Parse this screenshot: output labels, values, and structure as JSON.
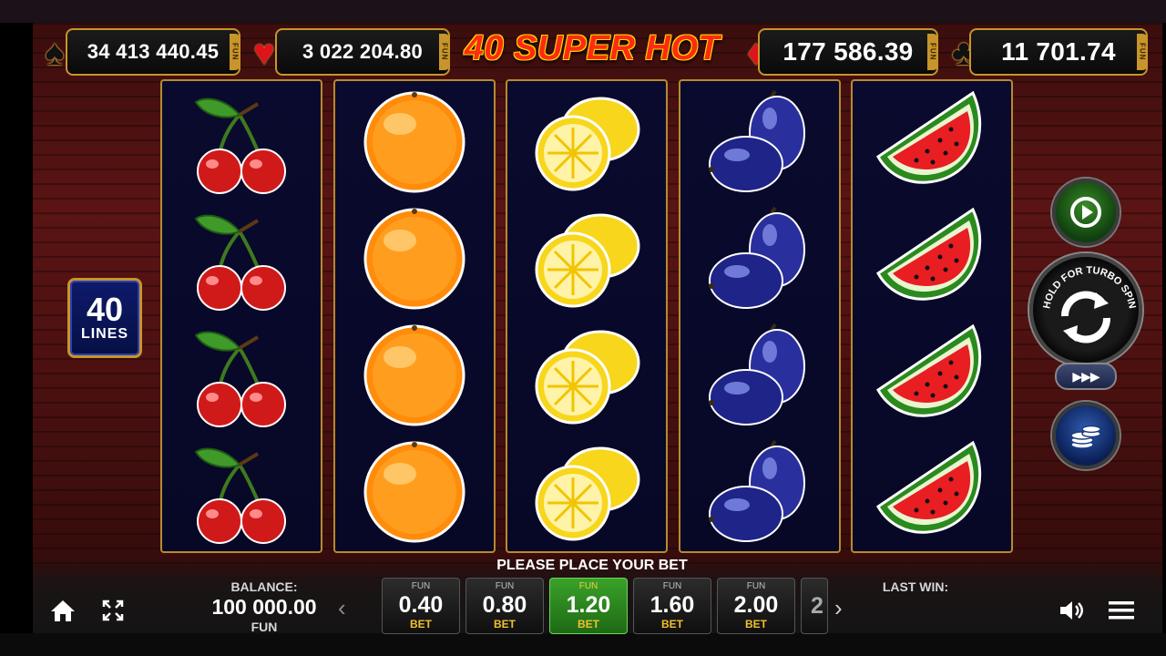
{
  "jackpots": [
    {
      "suit": "spade",
      "value": "34 413 440.45",
      "tag": "FUN"
    },
    {
      "suit": "heart",
      "value": "3 022 204.80",
      "tag": "FUN"
    },
    {
      "suit": "diamond",
      "value": "177 586.39",
      "tag": "FUN"
    },
    {
      "suit": "club",
      "value": "11 701.74",
      "tag": "FUN"
    }
  ],
  "suits": {
    "spade": "♠",
    "heart": "♥",
    "diamond": "♦",
    "club": "♣"
  },
  "title": "40 SUPER HOT",
  "lines": {
    "count": "40",
    "label": "LINES"
  },
  "reels": [
    {
      "symbol": "cherries",
      "rows": 4
    },
    {
      "symbol": "orange",
      "rows": 4
    },
    {
      "symbol": "lemon",
      "rows": 4
    },
    {
      "symbol": "plum",
      "rows": 4
    },
    {
      "symbol": "watermelon",
      "rows": 4
    }
  ],
  "controls": {
    "autoplay_icon": "replay-icon",
    "spin_hint": "HOLD FOR TURBO SPIN",
    "turbo_label": "▶▶▶",
    "bet_stack_icon": "coins-icon"
  },
  "bet_panel": {
    "prompt": "PLEASE PLACE YOUR BET",
    "options": [
      {
        "tag": "FUN",
        "value": "0.40",
        "label": "BET",
        "selected": false
      },
      {
        "tag": "FUN",
        "value": "0.80",
        "label": "BET",
        "selected": false
      },
      {
        "tag": "FUN",
        "value": "1.20",
        "label": "BET",
        "selected": true
      },
      {
        "tag": "FUN",
        "value": "1.60",
        "label": "BET",
        "selected": false
      },
      {
        "tag": "FUN",
        "value": "2.00",
        "label": "BET",
        "selected": false
      }
    ],
    "partial_option": "2",
    "scroll_left": "‹",
    "scroll_right": "›"
  },
  "balance": {
    "label": "BALANCE:",
    "value": "100 000.00",
    "currency": "FUN"
  },
  "last_win": {
    "label": "LAST WIN:"
  },
  "colors": {
    "frame_gold": "#c7952c",
    "selected_bet": "#3aa12a",
    "reel_bg": "#0a0a2e"
  }
}
